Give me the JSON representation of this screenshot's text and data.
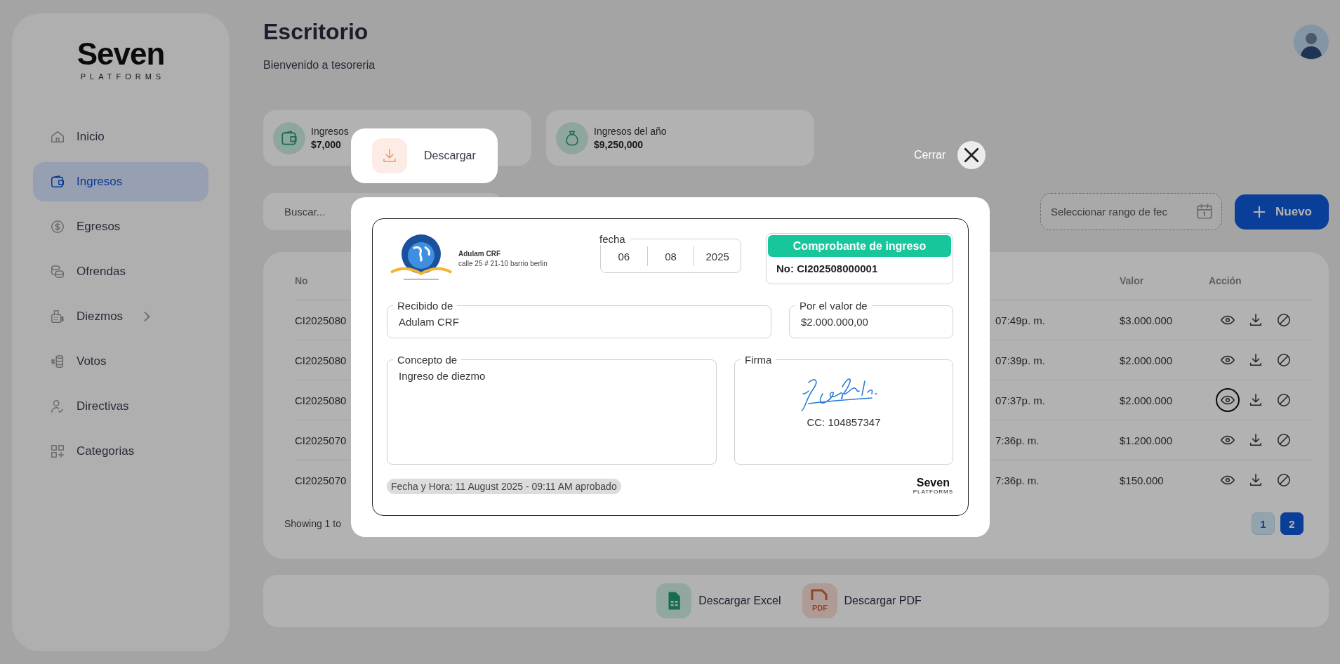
{
  "sidebar": {
    "logo": {
      "wordmark": "Seven",
      "tagline": "PLATFORMS"
    },
    "items": [
      {
        "label": "Inicio",
        "selected": false,
        "submenu": false
      },
      {
        "label": "Ingresos",
        "selected": true,
        "submenu": false
      },
      {
        "label": "Egresos",
        "selected": false,
        "submenu": false
      },
      {
        "label": "Ofrendas",
        "selected": false,
        "submenu": false
      },
      {
        "label": "Diezmos",
        "selected": false,
        "submenu": true
      },
      {
        "label": "Votos",
        "selected": false,
        "submenu": false
      },
      {
        "label": "Directivas",
        "selected": false,
        "submenu": false
      },
      {
        "label": "Categorias",
        "selected": false,
        "submenu": false
      }
    ]
  },
  "header": {
    "title": "Escritorio",
    "subtitle": "Bienvenido a tesoreria"
  },
  "stats": [
    {
      "label": "Ingresos",
      "value": "$7,000"
    },
    {
      "label": "Ingresos del año",
      "value": "$9,250,000"
    }
  ],
  "toolbar": {
    "search_placeholder": "Buscar...",
    "date_range_placeholder": "Seleccionar rango de fec",
    "new_button": "Nuevo"
  },
  "table": {
    "columns": [
      "No",
      "Valor",
      "Acción"
    ],
    "rows": [
      {
        "no": "CI2025080",
        "time": "07:49p. m.",
        "valor": "$3.000.000",
        "focused": false
      },
      {
        "no": "CI2025080",
        "time": "07:39p. m.",
        "valor": "$2.000.000",
        "focused": false
      },
      {
        "no": "CI2025080",
        "time": "07:37p. m.",
        "valor": "$2.000.000",
        "focused": true
      },
      {
        "no": "CI2025070",
        "time": "7:36p. m.",
        "valor": "$1.200.000",
        "focused": false
      },
      {
        "no": "CI2025070",
        "time": "7:36p. m.",
        "valor": "$150.000",
        "focused": false
      }
    ],
    "summary": "Showing 1 to",
    "pages": [
      {
        "label": "1",
        "selected": false
      },
      {
        "label": "2",
        "selected": true
      }
    ]
  },
  "exports": [
    {
      "kind": "excel",
      "label": "Descargar Excel"
    },
    {
      "kind": "pdf",
      "label": "Descargar PDF",
      "icon_text": "PDF"
    }
  ],
  "modal": {
    "download_label": "Descargar",
    "close_label": "Cerrar",
    "receipt": {
      "church_name": "Adulam CRF",
      "address": "calle 25 # 21-10 barrio berlin",
      "date_label": "fecha",
      "date": [
        "06",
        "08",
        "2025"
      ],
      "title": "Comprobante de ingreso",
      "number": "No: CI202508000001",
      "received_from": {
        "label": "Recibido de",
        "value": "Adulam CRF"
      },
      "amount": {
        "label": "Por el valor de",
        "value": "$2.000.000,00"
      },
      "concept": {
        "label": "Concepto de",
        "value": "Ingreso de diezmo"
      },
      "signature": {
        "label": "Firma",
        "id_text": "CC: 104857347"
      },
      "timestamp": "Fecha y Hora: 11 August 2025 - 09:11 AM aprobado",
      "brand": {
        "wordmark": "Seven",
        "tagline": "PLATFORMS"
      }
    }
  }
}
